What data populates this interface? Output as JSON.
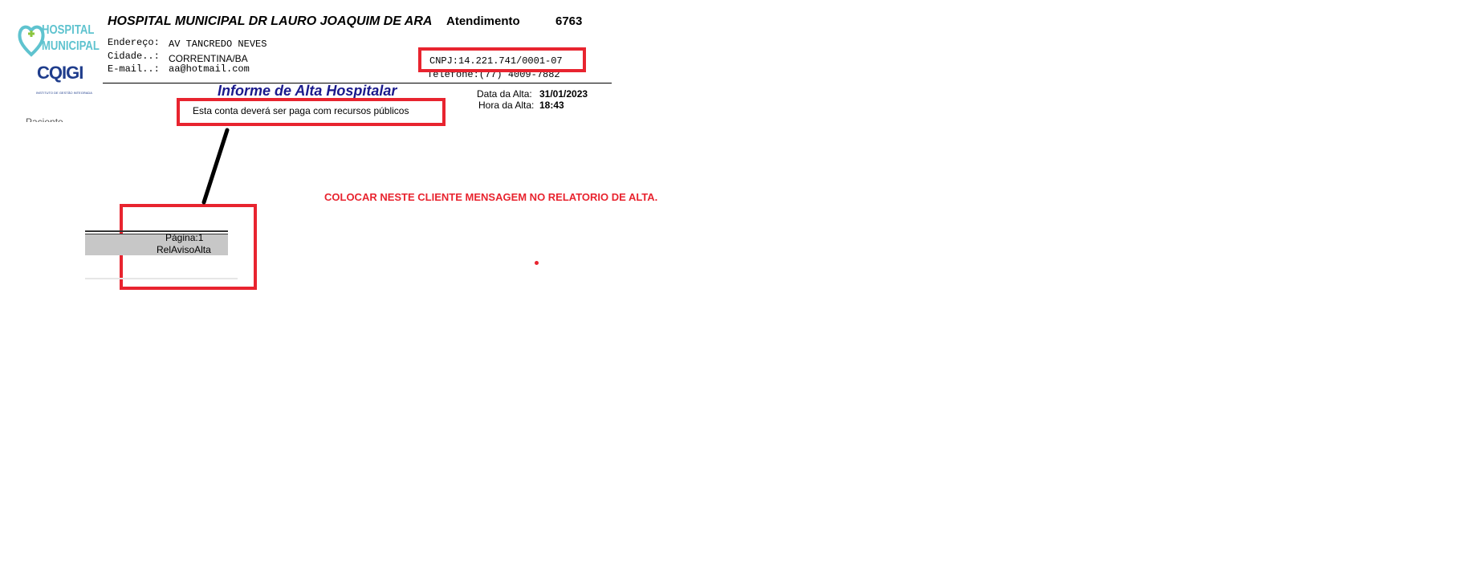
{
  "logo": {
    "line1": "HOSPITAL",
    "line2": "MUNICIPAL",
    "brand": "CQIGI",
    "tagline": "INSTITUTO DE GESTÃO INTEGRADA"
  },
  "header": {
    "hospital_name": "HOSPITAL MUNICIPAL DR LAURO JOAQUIM DE ARA",
    "atendimento_label": "Atendimento",
    "atendimento_number": "6763",
    "address_label": "Endereço:",
    "address_value": "AV TANCREDO NEVES",
    "city_label": "Cidade..:",
    "city_value": "CORRENTINA/BA",
    "email_label": "E-mail..:",
    "email_value": "aa@hotmail.com",
    "cnpj": "CNPJ:14.221.741/0001-07",
    "telefone": "Telefone:(77)  4009-7882"
  },
  "report": {
    "title": "Informe de Alta Hospitalar",
    "date_label": "Data da Alta:",
    "date_value": "31/01/2023",
    "time_label": "Hora da Alta:",
    "time_value": "18:43",
    "payment_message": "Esta conta deverá ser paga com recursos públicos",
    "cut_text": "Paciente"
  },
  "footer": {
    "page_label": "Página:1",
    "report_code": "RelAvisoAlta"
  },
  "annotation": {
    "instruction": "COLOCAR NESTE CLIENTE MENSAGEM NO RELATORIO DE ALTA.",
    "color": "#e8242f"
  }
}
